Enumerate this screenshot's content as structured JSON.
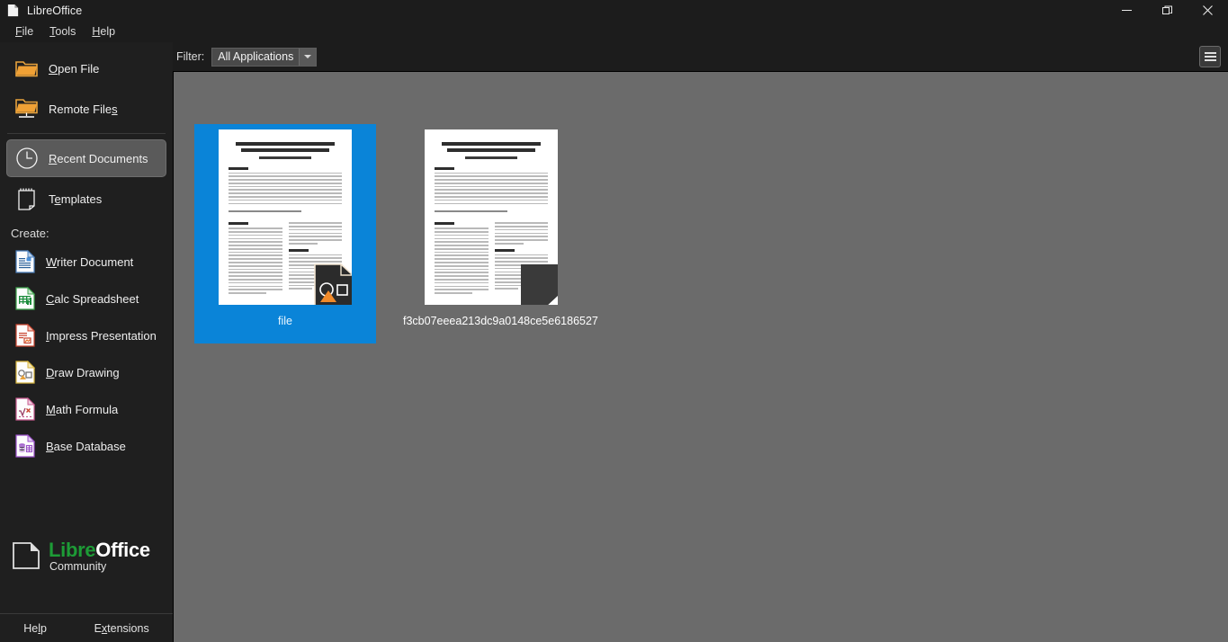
{
  "window": {
    "title": "LibreOffice",
    "app_icon": "document-icon",
    "controls": [
      {
        "name": "minimize-button",
        "glyph": "minimize-icon"
      },
      {
        "name": "restore-button",
        "glyph": "restore-icon"
      },
      {
        "name": "close-button",
        "glyph": "close-icon"
      }
    ]
  },
  "menubar": {
    "items": [
      {
        "label": "File",
        "accel": "F",
        "rest": "ile"
      },
      {
        "label": "Tools",
        "accel": "T",
        "rest": "ools"
      },
      {
        "label": "Help",
        "accel": "H",
        "rest": "elp"
      }
    ]
  },
  "toolbar": {
    "filter_label": "Filter:",
    "filter_value": "All Applications",
    "filter_options": [
      "All Applications"
    ],
    "view_toggle_icon": "hamburger-list-icon"
  },
  "sidebar": {
    "nav_items": [
      {
        "label": "Open File",
        "accel": "O",
        "rest": "pen File",
        "icon": "folder-icon",
        "selected": false
      },
      {
        "label": "Remote Files",
        "accel": "s",
        "pre": "Remote File",
        "rest": "",
        "icon": "remote-folder-icon",
        "selected": false
      },
      {
        "label": "Recent Documents",
        "accel": "R",
        "rest": "ecent Documents",
        "icon": "clock-icon",
        "selected": true
      },
      {
        "label": "Templates",
        "accel": "e",
        "pre": "T",
        "rest": "mplates",
        "icon": "notepad-icon",
        "selected": false
      }
    ],
    "create_label": "Create:",
    "create_items": [
      {
        "label": "Writer Document",
        "accel": "W",
        "rest": "riter Document",
        "icon": "writer-doc-icon",
        "color": "#2a6099"
      },
      {
        "label": "Calc Spreadsheet",
        "accel": "C",
        "rest": "alc Spreadsheet",
        "icon": "calc-doc-icon",
        "color": "#1e8e3e"
      },
      {
        "label": "Impress Presentation",
        "accel": "I",
        "rest": "mpress Presentation",
        "icon": "impress-doc-icon",
        "color": "#c9442e"
      },
      {
        "label": "Draw Drawing",
        "accel": "D",
        "rest": "raw Drawing",
        "icon": "draw-doc-icon",
        "color": "#d6b43c"
      },
      {
        "label": "Math Formula",
        "accel": "M",
        "rest": "ath Formula",
        "icon": "math-doc-icon",
        "color": "#c75a8e"
      },
      {
        "label": "Base Database",
        "accel": "B",
        "rest": "ase Database",
        "icon": "base-doc-icon",
        "color": "#9b51c9"
      }
    ],
    "brand": {
      "libre": "Libre",
      "office": "Office",
      "sub": "Community",
      "logo_icon": "libreoffice-logo-icon",
      "green": "#1d9b36"
    },
    "bottom_buttons": [
      {
        "label": "Help",
        "accel": "l",
        "pre": "He",
        "rest": "p"
      },
      {
        "label": "Extensions",
        "accel": "x",
        "pre": "E",
        "rest": "tensions"
      }
    ]
  },
  "content": {
    "background": "#6b6b6b",
    "selection_color": "#0a84d8",
    "documents": [
      {
        "name": "file",
        "selected": true,
        "overlay_icon": "draw-document-icon",
        "thumbnail": "scientific-paper-preview"
      },
      {
        "name": "f3cb07eeea213dc9a0148ce5e6186527",
        "selected": false,
        "overlay_icon": "generic-document-icon",
        "thumbnail": "scientific-paper-preview"
      }
    ]
  }
}
